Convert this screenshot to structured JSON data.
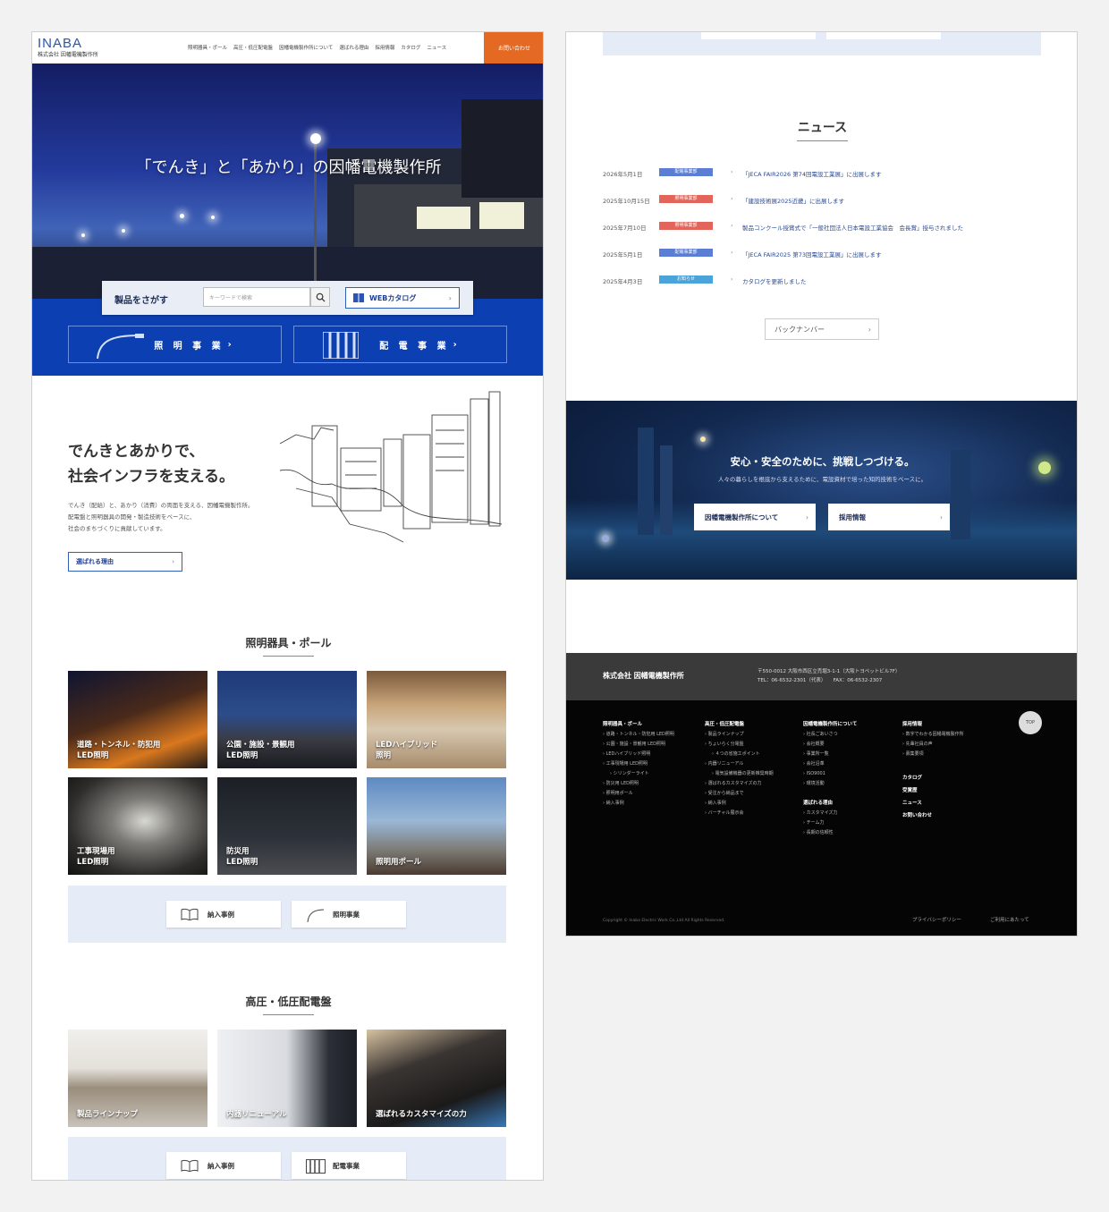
{
  "header": {
    "logo": "INABA",
    "logo_sub": "株式会社 因幡電機製作所",
    "nav": [
      "照明器具・ポール",
      "高圧・低圧配電盤",
      "因幡電機製作所について",
      "選ばれる理由",
      "採用情報",
      "カタログ",
      "ニュース"
    ],
    "contact": "お問い合わせ"
  },
  "hero": {
    "title": "「でんき」と「あかり」の因幡電機製作所"
  },
  "search": {
    "label": "製品をさがす",
    "placeholder": "キーワードで検索",
    "webcatalog": "WEBカタログ"
  },
  "business": [
    {
      "label": "照 明 事 業"
    },
    {
      "label": "配 電 事 業"
    }
  ],
  "about": {
    "heading1": "でんきとあかりで、",
    "heading2": "社会インフラを支える。",
    "p1": "でんき（配給）と、あかり（消費）の両面を支える、因幡電機製作所。",
    "p2": "配電盤と照明器具の開発・製造技術をベースに、",
    "p3": "社会のまちづくりに貢献しています。",
    "button": "選ばれる理由"
  },
  "lighting": {
    "title": "照明器具・ポール",
    "tiles": [
      {
        "l1": "道路・トンネル・防犯用",
        "l2": "LED照明"
      },
      {
        "l1": "公園・施設・景観用",
        "l2": "LED照明"
      },
      {
        "l1": "LEDハイブリッド",
        "l2": "照明"
      },
      {
        "l1": "工事現場用",
        "l2": "LED照明"
      },
      {
        "l1": "防災用",
        "l2": "LED照明"
      },
      {
        "l1": "照明用ポール",
        "l2": ""
      }
    ],
    "btn_case": "納入事例",
    "btn_biz": "照明事業"
  },
  "power": {
    "title": "高圧・低圧配電盤",
    "tiles": [
      {
        "l1": "製品ラインナップ"
      },
      {
        "l1": "内器リニューアル"
      },
      {
        "l1": "選ばれるカスタマイズの力"
      }
    ],
    "btn_case": "納入事例",
    "btn_biz": "配電事業"
  },
  "news": {
    "title": "ニュース",
    "items": [
      {
        "date": "2026年5月1日",
        "cat": "配電事業部",
        "color": "#5a7ed3",
        "text": "「JECA FAIR2026 第74回電設工業展」に出展します"
      },
      {
        "date": "2025年10月15日",
        "cat": "照明事業部",
        "color": "#e2645a",
        "text": "「建設技術展2025近畿」に出展します"
      },
      {
        "date": "2025年7月10日",
        "cat": "照明事業部",
        "color": "#e2645a",
        "text": "製品コンクール授賞式で「一般社団法人日本電設工業協会　会長賞」授与されました"
      },
      {
        "date": "2025年5月1日",
        "cat": "配電事業部",
        "color": "#5a7ed3",
        "text": "「JECA FAIR2025 第73回電設工業展」に出展します"
      },
      {
        "date": "2025年4月3日",
        "cat": "お知らせ",
        "color": "#4aa3d9",
        "text": "カタログを更新しました"
      }
    ],
    "backnumber": "バックナンバー"
  },
  "safety": {
    "heading": "安心・安全のために、挑戦しつづける。",
    "sub": "人々の暮らしを根底から支えるために、電設資材で培った知的技術をベースに。",
    "btn_about": "因幡電機製作所について",
    "btn_recruit": "採用情報"
  },
  "footer": {
    "company": "株式会社 因幡電機製作所",
    "addr1": "〒550-0012 大阪市西区立売堀3-1-1（大阪トヨペットビル7F）",
    "addr2": "TEL：06-6532-2301（代表）　　FAX：06-6532-2307",
    "col1_head": "照明器具・ポール",
    "col1": [
      "道路・トンネル・防犯用 LED照明",
      "公園・施設・景観用 LED照明",
      "LEDハイブリッド照明",
      "工事現場用 LED照明",
      "シリンダーライト",
      "防災用 LED照明",
      "照明用ポール",
      "納入事例"
    ],
    "col2_head": "高圧・低圧配電盤",
    "col2": [
      "製品ラインナップ",
      "ちょいらく分電盤",
      "４つの省施工ポイント",
      "内器リニューアル",
      "電気設備機器の更新推奨時期",
      "選ばれるカスタマイズの力",
      "受注から納品まで",
      "納入事例",
      "バーチャル展示会"
    ],
    "col3_head": "因幡電機製作所について",
    "col3": [
      "社長ごあいさつ",
      "会社概要",
      "事業所一覧",
      "会社沿革",
      "ISO9001",
      "環境活動"
    ],
    "col3b_head": "選ばれる理由",
    "col3b": [
      "カスタマイズ力",
      "チーム力",
      "長期の信頼性"
    ],
    "col4_head": "採用情報",
    "col4": [
      "数字でわかる因幡電機製作所",
      "先輩社員の声",
      "募集要項"
    ],
    "col4_links": [
      "カタログ",
      "受賞歴",
      "ニュース",
      "お問い合わせ"
    ],
    "top": "TOP",
    "copyright": "Copyright © Inaba Electric Work Co.,Ltd All Rights Reserved.",
    "privacy": "プライバシーポリシー",
    "terms": "ご利用にあたって"
  }
}
